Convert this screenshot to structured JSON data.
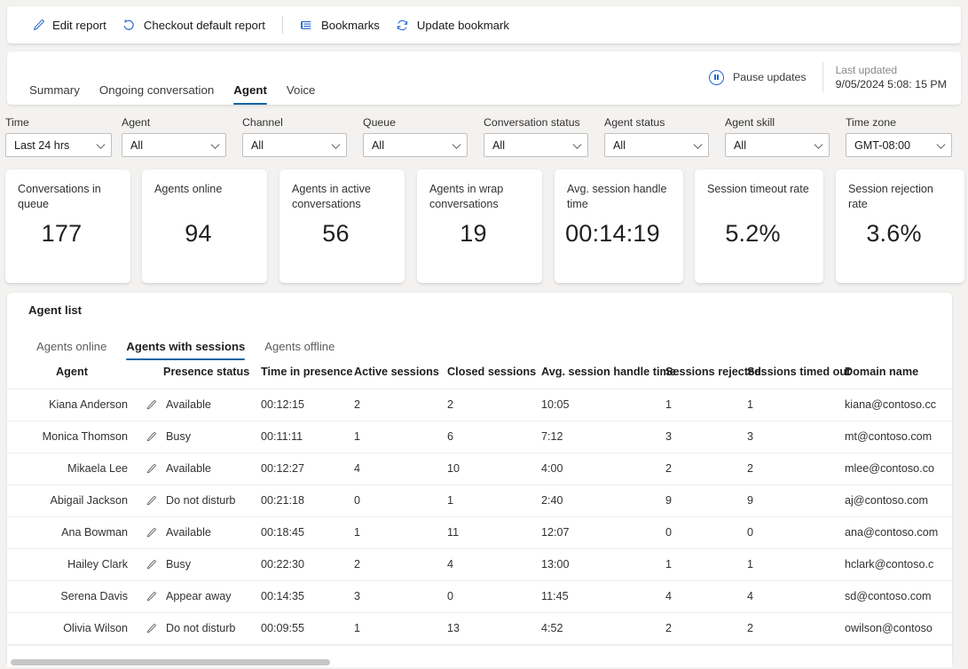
{
  "commandbar": {
    "items": [
      {
        "label": "Edit report",
        "icon": "pencil-icon"
      },
      {
        "label": "Checkout default report",
        "icon": "undo-icon"
      },
      {
        "label": "Bookmarks",
        "icon": "bookmark-list-icon"
      },
      {
        "label": "Update bookmark",
        "icon": "refresh-icon"
      }
    ]
  },
  "header": {
    "tabs": [
      {
        "label": "Summary",
        "active": false
      },
      {
        "label": "Ongoing conversation",
        "active": false
      },
      {
        "label": "Agent",
        "active": true
      },
      {
        "label": "Voice",
        "active": false
      }
    ],
    "pause_label": "Pause updates",
    "last_updated_label": "Last updated",
    "last_updated_value": "9/05/2024 5:08: 15 PM"
  },
  "filters": [
    {
      "label": "Time",
      "value": "Last 24 hrs",
      "width": 128
    },
    {
      "label": "Agent",
      "value": "All",
      "width": 120
    },
    {
      "label": "Channel",
      "value": "All",
      "width": 128
    },
    {
      "label": "Queue",
      "value": "All",
      "width": 120
    },
    {
      "label": "Conversation status",
      "value": "All",
      "width": 128
    },
    {
      "label": "Agent status",
      "value": "All",
      "width": 120
    },
    {
      "label": "Agent skill",
      "value": "All",
      "width": 128
    },
    {
      "label": "Time zone",
      "value": "GMT-08:00",
      "width": 120
    }
  ],
  "kpis": [
    {
      "title": "Conversations in queue",
      "value": "177"
    },
    {
      "title": "Agents online",
      "value": "94"
    },
    {
      "title": "Agents in active conversations",
      "value": "56"
    },
    {
      "title": "Agents in wrap conversations",
      "value": "19"
    },
    {
      "title": "Avg. session handle time",
      "value": "00:14:19"
    },
    {
      "title": "Session timeout rate",
      "value": "5.2%"
    },
    {
      "title": "Session rejection rate",
      "value": "3.6%"
    }
  ],
  "agent_list": {
    "title": "Agent list",
    "tabs": [
      {
        "label": "Agents online",
        "active": false
      },
      {
        "label": "Agents with sessions",
        "active": true
      },
      {
        "label": "Agents offline",
        "active": false
      }
    ],
    "columns": [
      "Agent",
      "Presence status",
      "Time in presence",
      "Active sessions",
      "Closed sessions",
      "Avg. session handle time",
      "Sessions rejected",
      "Sessions timed out",
      "Domain name"
    ],
    "rows": [
      {
        "agent": "Kiana Anderson",
        "presence": "Available",
        "time_in_presence": "00:12:15",
        "active_sessions": "2",
        "closed_sessions": "2",
        "avg_session_handle_time": "10:05",
        "sessions_rejected": "1",
        "sessions_timed_out": "1",
        "domain": "kiana@contoso.cc"
      },
      {
        "agent": "Monica Thomson",
        "presence": "Busy",
        "time_in_presence": "00:11:11",
        "active_sessions": "1",
        "closed_sessions": "6",
        "avg_session_handle_time": "7:12",
        "sessions_rejected": "3",
        "sessions_timed_out": "3",
        "domain": "mt@contoso.com"
      },
      {
        "agent": "Mikaela Lee",
        "presence": "Available",
        "time_in_presence": "00:12:27",
        "active_sessions": "4",
        "closed_sessions": "10",
        "avg_session_handle_time": "4:00",
        "sessions_rejected": "2",
        "sessions_timed_out": "2",
        "domain": "mlee@contoso.co"
      },
      {
        "agent": "Abigail Jackson",
        "presence": "Do not disturb",
        "time_in_presence": "00:21:18",
        "active_sessions": "0",
        "closed_sessions": "1",
        "avg_session_handle_time": "2:40",
        "sessions_rejected": "9",
        "sessions_timed_out": "9",
        "domain": "aj@contoso.com"
      },
      {
        "agent": "Ana Bowman",
        "presence": "Available",
        "time_in_presence": "00:18:45",
        "active_sessions": "1",
        "closed_sessions": "11",
        "avg_session_handle_time": "12:07",
        "sessions_rejected": "0",
        "sessions_timed_out": "0",
        "domain": "ana@contoso.com"
      },
      {
        "agent": "Hailey Clark",
        "presence": "Busy",
        "time_in_presence": "00:22:30",
        "active_sessions": "2",
        "closed_sessions": "4",
        "avg_session_handle_time": "13:00",
        "sessions_rejected": "1",
        "sessions_timed_out": "1",
        "domain": "hclark@contoso.c"
      },
      {
        "agent": "Serena Davis",
        "presence": "Appear away",
        "time_in_presence": "00:14:35",
        "active_sessions": "3",
        "closed_sessions": "0",
        "avg_session_handle_time": "11:45",
        "sessions_rejected": "4",
        "sessions_timed_out": "4",
        "domain": "sd@contoso.com"
      },
      {
        "agent": "Olivia Wilson",
        "presence": "Do not disturb",
        "time_in_presence": "00:09:55",
        "active_sessions": "1",
        "closed_sessions": "13",
        "avg_session_handle_time": "4:52",
        "sessions_rejected": "2",
        "sessions_timed_out": "2",
        "domain": "owilson@contoso"
      }
    ]
  },
  "colors": {
    "accent": "#1264a3",
    "icon_blue": "#2266cc",
    "page_bg": "#f3f2f1",
    "card_bg": "#ffffff"
  }
}
